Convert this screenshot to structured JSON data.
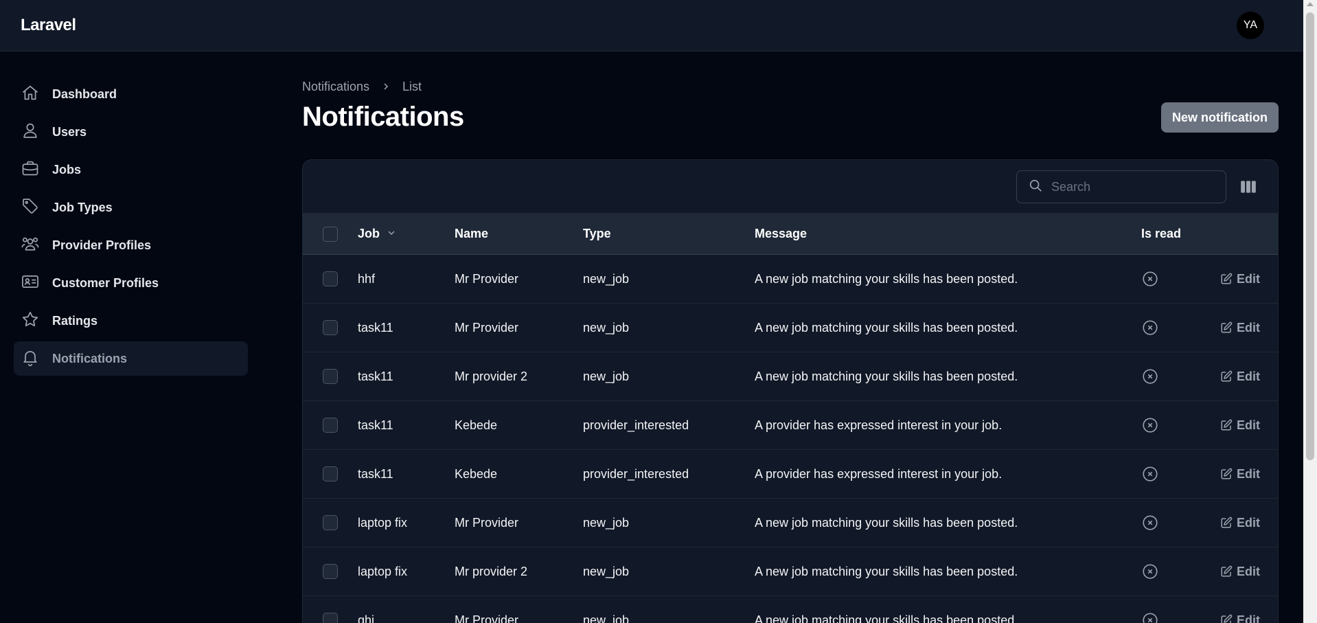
{
  "app": {
    "brand": "Laravel",
    "user_initials": "YA"
  },
  "sidebar": {
    "items": [
      {
        "label": "Dashboard",
        "icon": "home-icon",
        "active": false
      },
      {
        "label": "Users",
        "icon": "user-icon",
        "active": false
      },
      {
        "label": "Jobs",
        "icon": "briefcase-icon",
        "active": false
      },
      {
        "label": "Job Types",
        "icon": "tag-icon",
        "active": false
      },
      {
        "label": "Provider Profiles",
        "icon": "users-group-icon",
        "active": false
      },
      {
        "label": "Customer Profiles",
        "icon": "id-card-icon",
        "active": false
      },
      {
        "label": "Ratings",
        "icon": "star-icon",
        "active": false
      },
      {
        "label": "Notifications",
        "icon": "bell-icon",
        "active": true
      }
    ]
  },
  "breadcrumb": {
    "parent": "Notifications",
    "current": "List"
  },
  "page": {
    "title": "Notifications",
    "new_button": "New notification"
  },
  "table": {
    "search_placeholder": "Search",
    "columns": {
      "job": "Job",
      "name": "Name",
      "type": "Type",
      "message": "Message",
      "is_read": "Is read"
    },
    "action_label": "Edit",
    "rows": [
      {
        "job": "hhf",
        "name": "Mr Provider",
        "type": "new_job",
        "message": "A new job matching your skills has been posted."
      },
      {
        "job": "task11",
        "name": "Mr Provider",
        "type": "new_job",
        "message": "A new job matching your skills has been posted."
      },
      {
        "job": "task11",
        "name": "Mr provider 2",
        "type": "new_job",
        "message": "A new job matching your skills has been posted."
      },
      {
        "job": "task11",
        "name": "Kebede",
        "type": "provider_interested",
        "message": "A provider has expressed interest in your job."
      },
      {
        "job": "task11",
        "name": "Kebede",
        "type": "provider_interested",
        "message": "A provider has expressed interest in your job."
      },
      {
        "job": "laptop fix",
        "name": "Mr Provider",
        "type": "new_job",
        "message": "A new job matching your skills has been posted."
      },
      {
        "job": "laptop fix",
        "name": "Mr provider 2",
        "type": "new_job",
        "message": "A new job matching your skills has been posted."
      },
      {
        "job": "ghj",
        "name": "Mr Provider",
        "type": "new_job",
        "message": "A new job matching your skills has been posted."
      }
    ]
  }
}
